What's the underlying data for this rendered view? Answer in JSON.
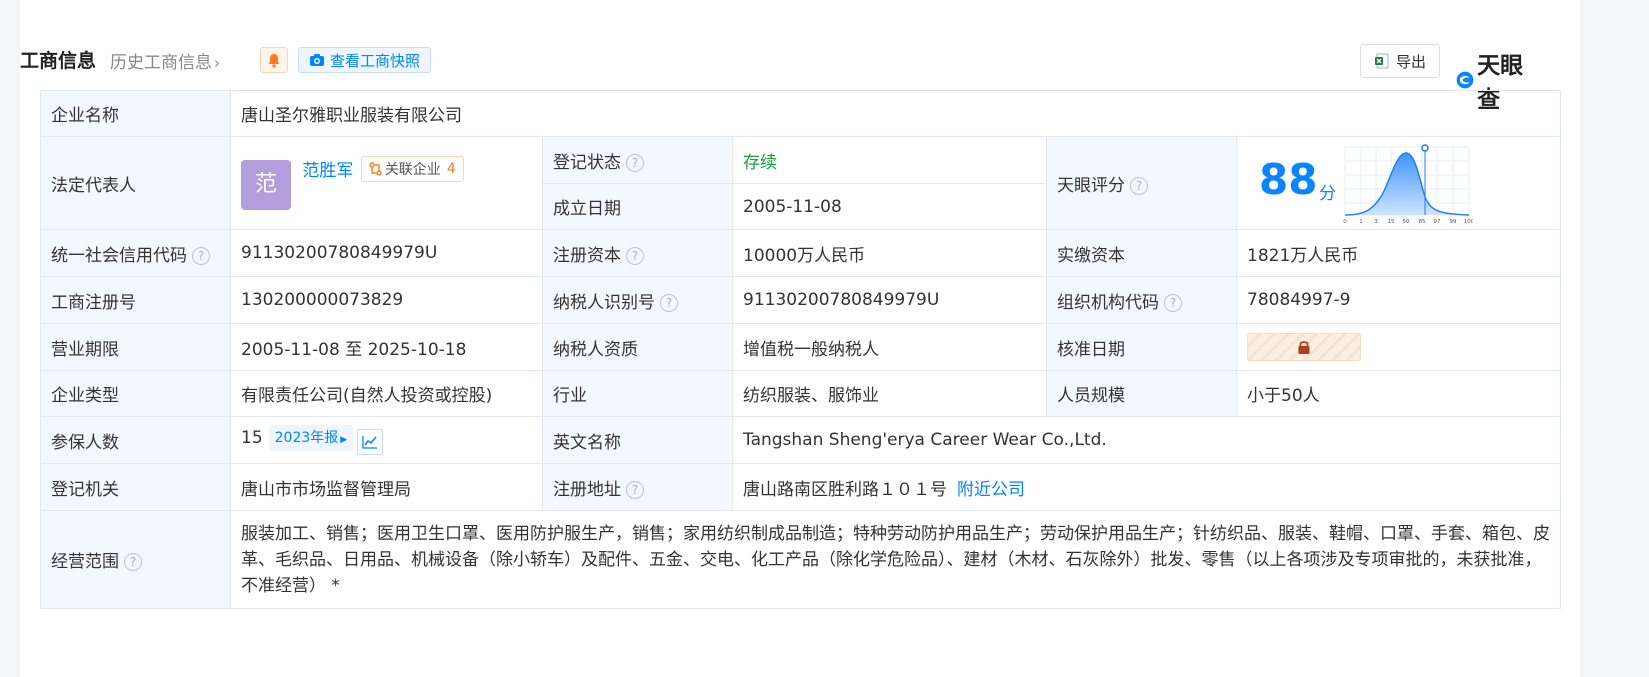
{
  "header": {
    "title": "工商信息",
    "history": "历史工商信息",
    "snapshot": "查看工商快照",
    "export": "导出",
    "logo": "天眼查"
  },
  "rows": {
    "company_name": {
      "label": "企业名称",
      "value": "唐山圣尔雅职业服装有限公司"
    },
    "legal_rep": {
      "label": "法定代表人",
      "avatar": "范",
      "name": "范胜军",
      "related_label": "关联企业",
      "related_count": "4"
    },
    "reg_status": {
      "label": "登记状态",
      "value": "存续"
    },
    "found_date": {
      "label": "成立日期",
      "value": "2005-11-08"
    },
    "score": {
      "label": "天眼评分",
      "value": "88",
      "unit": "分",
      "axis": [
        "0",
        "1",
        "3",
        "15",
        "50",
        "85",
        "97",
        "99",
        "100"
      ]
    },
    "credit_code": {
      "label": "统一社会信用代码",
      "value": "91130200780849979U"
    },
    "reg_capital": {
      "label": "注册资本",
      "value": "10000万人民币"
    },
    "paid_capital": {
      "label": "实缴资本",
      "value": "1821万人民币"
    },
    "reg_no": {
      "label": "工商注册号",
      "value": "130200000073829"
    },
    "taxpayer_id": {
      "label": "纳税人识别号",
      "value": "91130200780849979U"
    },
    "org_code": {
      "label": "组织机构代码",
      "value": "78084997-9"
    },
    "biz_term": {
      "label": "营业期限",
      "value": "2005-11-08 至 2025-10-18"
    },
    "taxpayer_qual": {
      "label": "纳税人资质",
      "value": "增值税一般纳税人"
    },
    "approve_date": {
      "label": "核准日期"
    },
    "company_type": {
      "label": "企业类型",
      "value": "有限责任公司(自然人投资或控股)"
    },
    "industry": {
      "label": "行业",
      "value": "纺织服装、服饰业"
    },
    "staff_size": {
      "label": "人员规模",
      "value": "小于50人"
    },
    "insured": {
      "label": "参保人数",
      "value": "15",
      "year": "2023年报"
    },
    "english_name": {
      "label": "英文名称",
      "value": "Tangshan Sheng'erya Career Wear Co.,Ltd."
    },
    "reg_authority": {
      "label": "登记机关",
      "value": "唐山市市场监督管理局"
    },
    "reg_address": {
      "label": "注册地址",
      "value": "唐山路南区胜利路１０１号",
      "nearby": "附近公司"
    },
    "scope": {
      "label": "经营范围",
      "value": "服装加工、销售；医用卫生口罩、医用防护服生产，销售；家用纺织制成品制造；特种劳动防护用品生产；劳动保护用品生产；针纺织品、服装、鞋帽、口罩、手套、箱包、皮革、毛织品、日用品、机械设备（除小轿车）及配件、五金、交电、化工产品（除化学危险品）、建材（木材、石灰除外）批发、零售（以上各项涉及专项审批的，未获批准，不准经营） *"
    }
  }
}
